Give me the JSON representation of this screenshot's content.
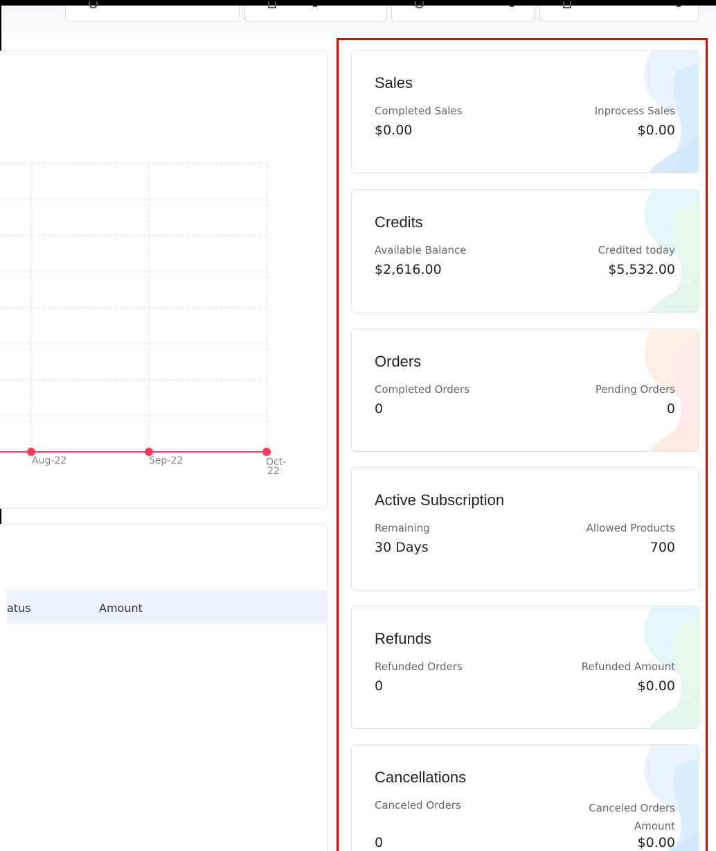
{
  "chart": {
    "x_ticks": [
      "Aug-22",
      "Sep-22",
      "Oct-22"
    ],
    "line_color": "#ff3b5c"
  },
  "chart_data": {
    "type": "line",
    "categories": [
      "Aug-22",
      "Sep-22",
      "Oct-22"
    ],
    "series": [
      {
        "values": [
          0,
          0,
          0
        ]
      }
    ]
  },
  "table": {
    "headers": [
      "atus",
      "Amount"
    ]
  },
  "stats": [
    {
      "title": "Sales",
      "left_label": "Completed Sales",
      "left_value": "$0.00",
      "right_label": "Inprocess Sales",
      "right_value": "$0.00",
      "tint": "blue"
    },
    {
      "title": "Credits",
      "left_label": "Available Balance",
      "left_value": "$2,616.00",
      "right_label": "Credited today",
      "right_value": "$5,532.00",
      "tint": "green"
    },
    {
      "title": "Orders",
      "left_label": "Completed Orders",
      "left_value": "0",
      "right_label": "Pending Orders",
      "right_value": "0",
      "tint": "peach"
    },
    {
      "title": "Active Subscription",
      "left_label": "Remaining",
      "left_value": "30 Days",
      "right_label": "Allowed Products",
      "right_value": "700",
      "tint": "none"
    },
    {
      "title": "Refunds",
      "left_label": "Refunded Orders",
      "left_value": "0",
      "right_label": "Refunded Amount",
      "right_value": "$0.00",
      "tint": "green"
    },
    {
      "title": "Cancellations",
      "left_label": "Canceled Orders",
      "left_value": "0",
      "right_label": "Canceled Orders Amount",
      "right_value": "$0.00",
      "tint": "blue"
    }
  ],
  "colors": {
    "highlight": "#e60000",
    "table_header_bg": "#eef4fd"
  }
}
